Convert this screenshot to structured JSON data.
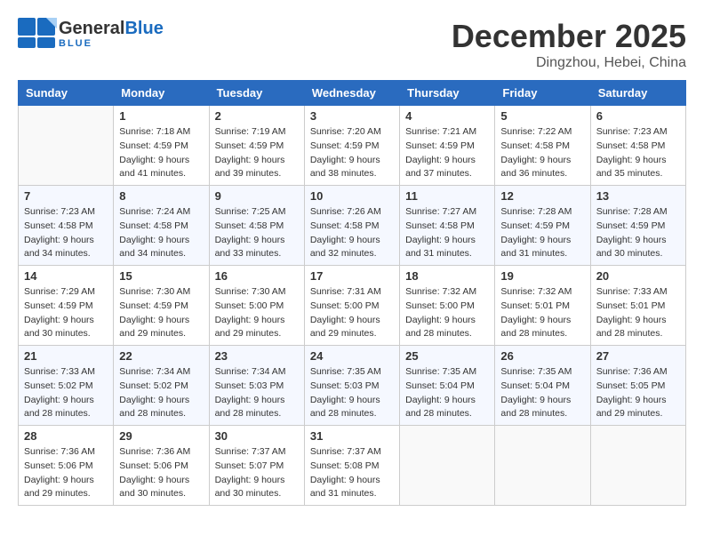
{
  "header": {
    "logo_general": "General",
    "logo_blue": "Blue",
    "month": "December 2025",
    "location": "Dingzhou, Hebei, China"
  },
  "weekdays": [
    "Sunday",
    "Monday",
    "Tuesday",
    "Wednesday",
    "Thursday",
    "Friday",
    "Saturday"
  ],
  "weeks": [
    [
      {
        "day": "",
        "info": ""
      },
      {
        "day": "1",
        "info": "Sunrise: 7:18 AM\nSunset: 4:59 PM\nDaylight: 9 hours\nand 41 minutes."
      },
      {
        "day": "2",
        "info": "Sunrise: 7:19 AM\nSunset: 4:59 PM\nDaylight: 9 hours\nand 39 minutes."
      },
      {
        "day": "3",
        "info": "Sunrise: 7:20 AM\nSunset: 4:59 PM\nDaylight: 9 hours\nand 38 minutes."
      },
      {
        "day": "4",
        "info": "Sunrise: 7:21 AM\nSunset: 4:59 PM\nDaylight: 9 hours\nand 37 minutes."
      },
      {
        "day": "5",
        "info": "Sunrise: 7:22 AM\nSunset: 4:58 PM\nDaylight: 9 hours\nand 36 minutes."
      },
      {
        "day": "6",
        "info": "Sunrise: 7:23 AM\nSunset: 4:58 PM\nDaylight: 9 hours\nand 35 minutes."
      }
    ],
    [
      {
        "day": "7",
        "info": "Sunrise: 7:23 AM\nSunset: 4:58 PM\nDaylight: 9 hours\nand 34 minutes."
      },
      {
        "day": "8",
        "info": "Sunrise: 7:24 AM\nSunset: 4:58 PM\nDaylight: 9 hours\nand 34 minutes."
      },
      {
        "day": "9",
        "info": "Sunrise: 7:25 AM\nSunset: 4:58 PM\nDaylight: 9 hours\nand 33 minutes."
      },
      {
        "day": "10",
        "info": "Sunrise: 7:26 AM\nSunset: 4:58 PM\nDaylight: 9 hours\nand 32 minutes."
      },
      {
        "day": "11",
        "info": "Sunrise: 7:27 AM\nSunset: 4:58 PM\nDaylight: 9 hours\nand 31 minutes."
      },
      {
        "day": "12",
        "info": "Sunrise: 7:28 AM\nSunset: 4:59 PM\nDaylight: 9 hours\nand 31 minutes."
      },
      {
        "day": "13",
        "info": "Sunrise: 7:28 AM\nSunset: 4:59 PM\nDaylight: 9 hours\nand 30 minutes."
      }
    ],
    [
      {
        "day": "14",
        "info": "Sunrise: 7:29 AM\nSunset: 4:59 PM\nDaylight: 9 hours\nand 30 minutes."
      },
      {
        "day": "15",
        "info": "Sunrise: 7:30 AM\nSunset: 4:59 PM\nDaylight: 9 hours\nand 29 minutes."
      },
      {
        "day": "16",
        "info": "Sunrise: 7:30 AM\nSunset: 5:00 PM\nDaylight: 9 hours\nand 29 minutes."
      },
      {
        "day": "17",
        "info": "Sunrise: 7:31 AM\nSunset: 5:00 PM\nDaylight: 9 hours\nand 29 minutes."
      },
      {
        "day": "18",
        "info": "Sunrise: 7:32 AM\nSunset: 5:00 PM\nDaylight: 9 hours\nand 28 minutes."
      },
      {
        "day": "19",
        "info": "Sunrise: 7:32 AM\nSunset: 5:01 PM\nDaylight: 9 hours\nand 28 minutes."
      },
      {
        "day": "20",
        "info": "Sunrise: 7:33 AM\nSunset: 5:01 PM\nDaylight: 9 hours\nand 28 minutes."
      }
    ],
    [
      {
        "day": "21",
        "info": "Sunrise: 7:33 AM\nSunset: 5:02 PM\nDaylight: 9 hours\nand 28 minutes."
      },
      {
        "day": "22",
        "info": "Sunrise: 7:34 AM\nSunset: 5:02 PM\nDaylight: 9 hours\nand 28 minutes."
      },
      {
        "day": "23",
        "info": "Sunrise: 7:34 AM\nSunset: 5:03 PM\nDaylight: 9 hours\nand 28 minutes."
      },
      {
        "day": "24",
        "info": "Sunrise: 7:35 AM\nSunset: 5:03 PM\nDaylight: 9 hours\nand 28 minutes."
      },
      {
        "day": "25",
        "info": "Sunrise: 7:35 AM\nSunset: 5:04 PM\nDaylight: 9 hours\nand 28 minutes."
      },
      {
        "day": "26",
        "info": "Sunrise: 7:35 AM\nSunset: 5:04 PM\nDaylight: 9 hours\nand 28 minutes."
      },
      {
        "day": "27",
        "info": "Sunrise: 7:36 AM\nSunset: 5:05 PM\nDaylight: 9 hours\nand 29 minutes."
      }
    ],
    [
      {
        "day": "28",
        "info": "Sunrise: 7:36 AM\nSunset: 5:06 PM\nDaylight: 9 hours\nand 29 minutes."
      },
      {
        "day": "29",
        "info": "Sunrise: 7:36 AM\nSunset: 5:06 PM\nDaylight: 9 hours\nand 30 minutes."
      },
      {
        "day": "30",
        "info": "Sunrise: 7:37 AM\nSunset: 5:07 PM\nDaylight: 9 hours\nand 30 minutes."
      },
      {
        "day": "31",
        "info": "Sunrise: 7:37 AM\nSunset: 5:08 PM\nDaylight: 9 hours\nand 31 minutes."
      },
      {
        "day": "",
        "info": ""
      },
      {
        "day": "",
        "info": ""
      },
      {
        "day": "",
        "info": ""
      }
    ]
  ]
}
